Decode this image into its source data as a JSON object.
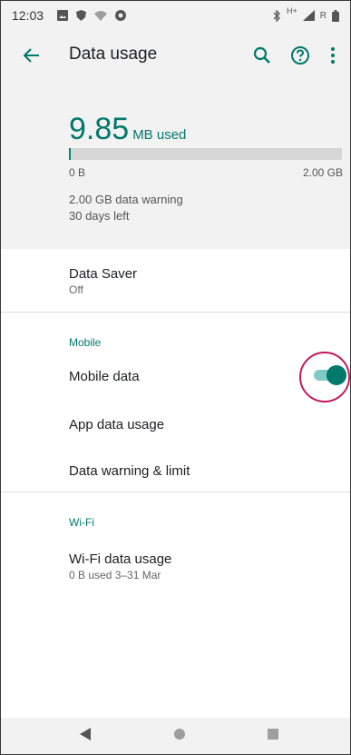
{
  "status_bar": {
    "time": "12:03",
    "icons_left": [
      "gallery-icon",
      "shield-icon",
      "wifi-icon",
      "chrome-icon"
    ],
    "icons_right": [
      "bluetooth-icon",
      "signal-icon",
      "battery-icon"
    ],
    "network_label": "H+"
  },
  "app_bar": {
    "title": "Data usage",
    "back_icon": "arrow-back-icon",
    "search_icon": "search-icon",
    "help_icon": "help-icon",
    "more_icon": "more-vert-icon"
  },
  "summary": {
    "usage_value": "9.85",
    "usage_unit": "MB used",
    "bar_min_label": "0 B",
    "bar_max_label": "2.00 GB",
    "bar_fraction": 0.005,
    "warning": "2.00 GB data warning",
    "days_left": "30 days left"
  },
  "data_saver": {
    "title": "Data Saver",
    "subtitle": "Off"
  },
  "mobile_section": {
    "header": "Mobile",
    "mobile_data": {
      "title": "Mobile data",
      "enabled": true
    },
    "app_data_usage": "App data usage",
    "data_warning_limit": "Data warning & limit"
  },
  "wifi_section": {
    "header": "Wi-Fi",
    "wifi_data_usage": {
      "title": "Wi-Fi data usage",
      "subtitle": "0 B used 3–31 Mar"
    }
  },
  "nav_bar": {
    "back": "nav-back-icon",
    "home": "nav-home-icon",
    "recents": "nav-recents-icon"
  },
  "colors": {
    "accent": "#00796b",
    "track": "#80cbc4",
    "highlight_ring": "#c2185b"
  }
}
